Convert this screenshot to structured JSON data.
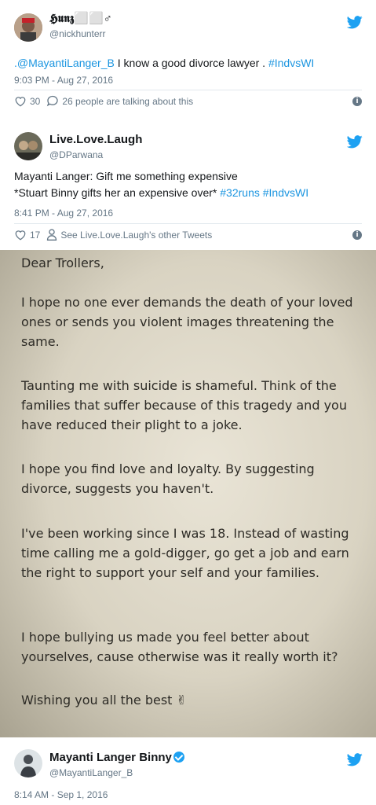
{
  "tweets": [
    {
      "display_name": "𝕳𝖚𝖓𝖟⬜⬜♂",
      "handle": "@nickhunterr",
      "text_prefix": ".@MayantiLanger_B",
      "text_main": " I know a good divorce lawyer . ",
      "hashtag": "#IndvsWI",
      "timestamp": "9:03 PM - Aug 27, 2016",
      "likes": "30",
      "comments_text": "26 people are talking about this"
    },
    {
      "display_name": "Live.Love.Laugh",
      "handle": "@DParwana",
      "line1": "Mayanti Langer: Gift me something expensive",
      "line2_text": "*Stuart Binny gifts her an expensive over* ",
      "hashtag1": "#32runs",
      "hashtag2": "#IndvsWI",
      "timestamp": "8:41 PM - Aug 27, 2016",
      "likes": "17",
      "profile_text": "See Live.Love.Laugh's other Tweets"
    },
    {
      "display_name": "Mayanti Langer Binny",
      "handle": "@MayantiLanger_B",
      "timestamp": "8:14 AM - Sep 1, 2016"
    }
  ],
  "letter": {
    "salutation": "Dear Trollers,",
    "p1": "I hope no one ever demands the death of your loved ones or sends you violent images threatening the same.",
    "p2": "Taunting me with suicide is shameful. Think of the families that suffer because of this tragedy and you have reduced their plight to a joke.",
    "p3": "I hope you find love and loyalty. By suggesting divorce, suggests you haven't.",
    "p4": "I've been working since I was 18. Instead of wasting time calling me a gold-digger, go get a job and earn the right to support your self and your families.",
    "p5": "I hope bullying us made you feel better about yourselves, cause otherwise was it really worth it?",
    "closing": "Wishing you all the best ✌"
  },
  "icons": {
    "twitter": "twitter-bird-icon",
    "heart": "heart-icon",
    "comment": "comment-icon",
    "person": "person-icon",
    "info": "info-icon",
    "verified": "verified-badge-icon"
  },
  "colors": {
    "link": "#1b95e0",
    "twitter_blue": "#1da1f2",
    "meta_gray": "#657786"
  }
}
